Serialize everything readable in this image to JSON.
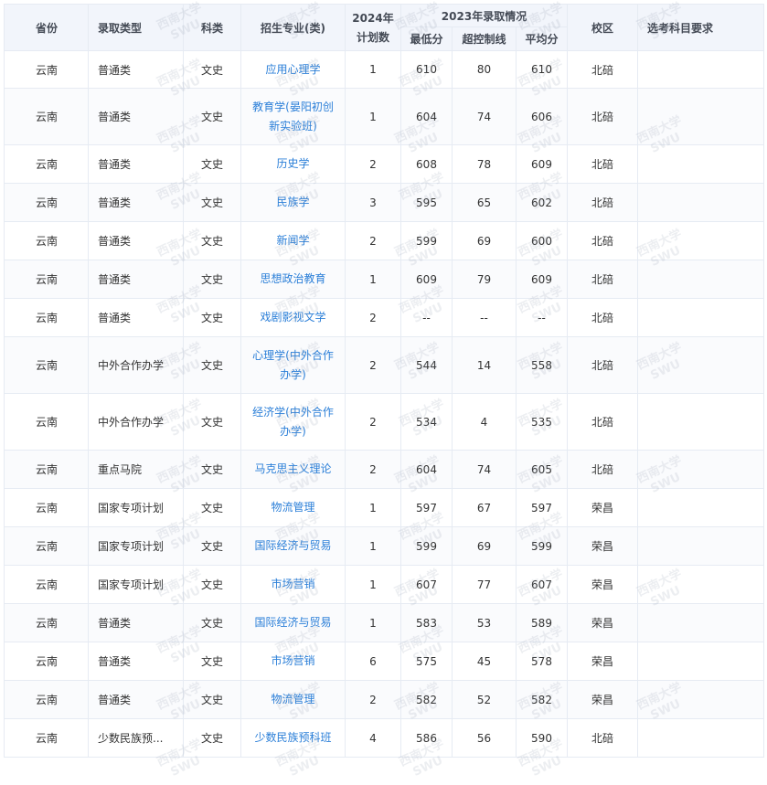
{
  "headers": {
    "province": "省份",
    "type": "录取类型",
    "subject": "科类",
    "major": "招生专业(类)",
    "plan_line1": "2024年",
    "plan_line2": "计划数",
    "group2023": "2023年录取情况",
    "min": "最低分",
    "over": "超控制线",
    "avg": "平均分",
    "campus": "校区",
    "req": "选考科目要求"
  },
  "watermark": {
    "line1": "西南大学",
    "line2": "SWU"
  },
  "rows": [
    {
      "province": "云南",
      "type": "普通类",
      "subject": "文史",
      "major": "应用心理学",
      "plan": "1",
      "min": "610",
      "over": "80",
      "avg": "610",
      "campus": "北碚",
      "req": ""
    },
    {
      "province": "云南",
      "type": "普通类",
      "subject": "文史",
      "major": "教育学(晏阳初创新实验班)",
      "plan": "1",
      "min": "604",
      "over": "74",
      "avg": "606",
      "campus": "北碚",
      "req": ""
    },
    {
      "province": "云南",
      "type": "普通类",
      "subject": "文史",
      "major": "历史学",
      "plan": "2",
      "min": "608",
      "over": "78",
      "avg": "609",
      "campus": "北碚",
      "req": ""
    },
    {
      "province": "云南",
      "type": "普通类",
      "subject": "文史",
      "major": "民族学",
      "plan": "3",
      "min": "595",
      "over": "65",
      "avg": "602",
      "campus": "北碚",
      "req": ""
    },
    {
      "province": "云南",
      "type": "普通类",
      "subject": "文史",
      "major": "新闻学",
      "plan": "2",
      "min": "599",
      "over": "69",
      "avg": "600",
      "campus": "北碚",
      "req": ""
    },
    {
      "province": "云南",
      "type": "普通类",
      "subject": "文史",
      "major": "思想政治教育",
      "plan": "1",
      "min": "609",
      "over": "79",
      "avg": "609",
      "campus": "北碚",
      "req": ""
    },
    {
      "province": "云南",
      "type": "普通类",
      "subject": "文史",
      "major": "戏剧影视文学",
      "plan": "2",
      "min": "--",
      "over": "--",
      "avg": "--",
      "campus": "北碚",
      "req": ""
    },
    {
      "province": "云南",
      "type": "中外合作办学",
      "subject": "文史",
      "major": "心理学(中外合作办学)",
      "plan": "2",
      "min": "544",
      "over": "14",
      "avg": "558",
      "campus": "北碚",
      "req": ""
    },
    {
      "province": "云南",
      "type": "中外合作办学",
      "subject": "文史",
      "major": "经济学(中外合作办学)",
      "plan": "2",
      "min": "534",
      "over": "4",
      "avg": "535",
      "campus": "北碚",
      "req": ""
    },
    {
      "province": "云南",
      "type": "重点马院",
      "subject": "文史",
      "major": "马克思主义理论",
      "plan": "2",
      "min": "604",
      "over": "74",
      "avg": "605",
      "campus": "北碚",
      "req": ""
    },
    {
      "province": "云南",
      "type": "国家专项计划",
      "subject": "文史",
      "major": "物流管理",
      "plan": "1",
      "min": "597",
      "over": "67",
      "avg": "597",
      "campus": "荣昌",
      "req": ""
    },
    {
      "province": "云南",
      "type": "国家专项计划",
      "subject": "文史",
      "major": "国际经济与贸易",
      "plan": "1",
      "min": "599",
      "over": "69",
      "avg": "599",
      "campus": "荣昌",
      "req": ""
    },
    {
      "province": "云南",
      "type": "国家专项计划",
      "subject": "文史",
      "major": "市场营销",
      "plan": "1",
      "min": "607",
      "over": "77",
      "avg": "607",
      "campus": "荣昌",
      "req": ""
    },
    {
      "province": "云南",
      "type": "普通类",
      "subject": "文史",
      "major": "国际经济与贸易",
      "plan": "1",
      "min": "583",
      "over": "53",
      "avg": "589",
      "campus": "荣昌",
      "req": ""
    },
    {
      "province": "云南",
      "type": "普通类",
      "subject": "文史",
      "major": "市场营销",
      "plan": "6",
      "min": "575",
      "over": "45",
      "avg": "578",
      "campus": "荣昌",
      "req": ""
    },
    {
      "province": "云南",
      "type": "普通类",
      "subject": "文史",
      "major": "物流管理",
      "plan": "2",
      "min": "582",
      "over": "52",
      "avg": "582",
      "campus": "荣昌",
      "req": ""
    },
    {
      "province": "云南",
      "type": "少数民族预...",
      "subject": "文史",
      "major": "少数民族预科班",
      "plan": "4",
      "min": "586",
      "over": "56",
      "avg": "590",
      "campus": "北碚",
      "req": ""
    }
  ]
}
